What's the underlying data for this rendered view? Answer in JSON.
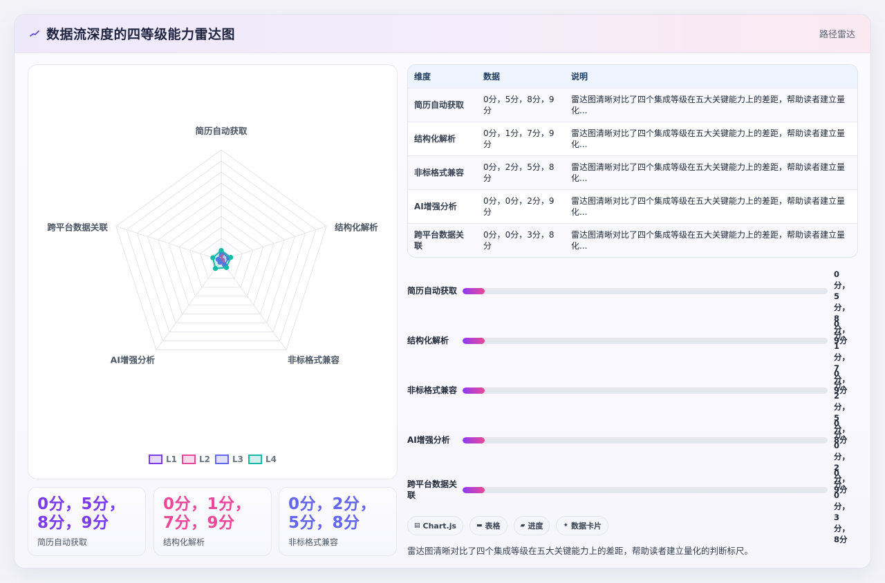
{
  "header": {
    "title": "数据流深度的四等级能力雷达图",
    "icon": "chart-line-icon",
    "link": "路径雷达"
  },
  "table": {
    "headers": [
      "维度",
      "数据",
      "说明"
    ],
    "rows": [
      {
        "dim": "简历自动获取",
        "data": "0分，5分，8分，9分",
        "desc": "雷达图清晰对比了四个集成等级在五大关键能力上的差距，帮助读者建立量化..."
      },
      {
        "dim": "结构化解析",
        "data": "0分，1分，7分，9分",
        "desc": "雷达图清晰对比了四个集成等级在五大关键能力上的差距，帮助读者建立量化..."
      },
      {
        "dim": "非标格式兼容",
        "data": "0分，2分，5分，8分",
        "desc": "雷达图清晰对比了四个集成等级在五大关键能力上的差距，帮助读者建立量化..."
      },
      {
        "dim": "AI增强分析",
        "data": "0分，0分，2分，9分",
        "desc": "雷达图清晰对比了四个集成等级在五大关键能力上的差距，帮助读者建立量化..."
      },
      {
        "dim": "跨平台数据关联",
        "data": "0分，0分，3分，8分",
        "desc": "雷达图清晰对比了四个集成等级在五大关键能力上的差距，帮助读者建立量化..."
      }
    ]
  },
  "bars": [
    {
      "label": "简历自动获取",
      "value": "0分，5分，8分，9分",
      "fill_pct": 6
    },
    {
      "label": "结构化解析",
      "value": "0分，1分，7分，9分",
      "fill_pct": 6
    },
    {
      "label": "非标格式兼容",
      "value": "0分，2分，5分，8分",
      "fill_pct": 6
    },
    {
      "label": "AI增强分析",
      "value": "0分，0分，2分，9分",
      "fill_pct": 6
    },
    {
      "label": "跨平台数据关联",
      "value": "0分，0分，3分，8分",
      "fill_pct": 6
    }
  ],
  "stat_cards": [
    {
      "value": "0分，5分，8分，9分",
      "label": "简历自动获取",
      "color": "#7c3aed"
    },
    {
      "value": "0分，1分，7分，9分",
      "label": "结构化解析",
      "color": "#ec4899"
    },
    {
      "value": "0分，2分，5分，8分",
      "label": "非标格式兼容",
      "color": "#6366f1"
    }
  ],
  "chips": [
    {
      "label": "Chart.js",
      "icon": "▤"
    },
    {
      "label": "表格",
      "icon": "▬"
    },
    {
      "label": "进度",
      "icon": "▰"
    },
    {
      "label": "数据卡片",
      "icon": "✦"
    }
  ],
  "footer": "雷达图清晰对比了四个集成等级在五大关键能力上的差距，帮助读者建立量化的判断标尺。",
  "chart_data": {
    "type": "radar",
    "categories": [
      "简历自动获取",
      "结构化解析",
      "非标格式兼容",
      "AI增强分析",
      "跨平台数据关联"
    ],
    "series": [
      {
        "name": "L1",
        "values": [
          0,
          0,
          0,
          0,
          0
        ],
        "color": "#7c3aed"
      },
      {
        "name": "L2",
        "values": [
          5,
          1,
          2,
          0,
          0
        ],
        "color": "#ec4899"
      },
      {
        "name": "L3",
        "values": [
          8,
          7,
          5,
          2,
          3
        ],
        "color": "#6366f1"
      },
      {
        "name": "L4",
        "values": [
          9,
          9,
          8,
          9,
          8
        ],
        "color": "#14b8a6"
      }
    ],
    "rlim": [
      0,
      100
    ],
    "grid": true,
    "legend": "bottom"
  }
}
